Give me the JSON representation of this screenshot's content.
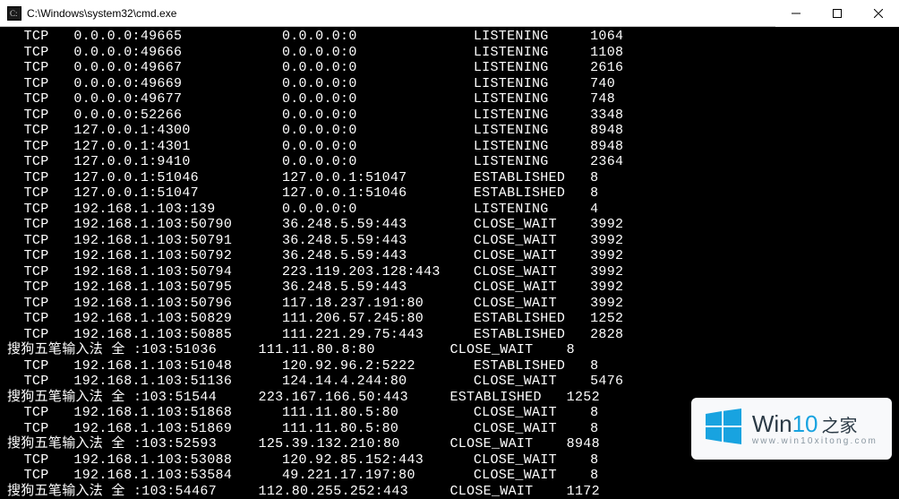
{
  "window": {
    "title": "C:\\Windows\\system32\\cmd.exe"
  },
  "columns": {
    "col1_width": 8,
    "col2_width": 25,
    "col3_width": 23,
    "col4_width": 14
  },
  "rows": [
    {
      "proto": "  TCP",
      "local": "0.0.0.0:49665",
      "remote": "0.0.0.0:0",
      "state": "LISTENING",
      "pid": "1064"
    },
    {
      "proto": "  TCP",
      "local": "0.0.0.0:49666",
      "remote": "0.0.0.0:0",
      "state": "LISTENING",
      "pid": "1108"
    },
    {
      "proto": "  TCP",
      "local": "0.0.0.0:49667",
      "remote": "0.0.0.0:0",
      "state": "LISTENING",
      "pid": "2616"
    },
    {
      "proto": "  TCP",
      "local": "0.0.0.0:49669",
      "remote": "0.0.0.0:0",
      "state": "LISTENING",
      "pid": "740"
    },
    {
      "proto": "  TCP",
      "local": "0.0.0.0:49677",
      "remote": "0.0.0.0:0",
      "state": "LISTENING",
      "pid": "748"
    },
    {
      "proto": "  TCP",
      "local": "0.0.0.0:52266",
      "remote": "0.0.0.0:0",
      "state": "LISTENING",
      "pid": "3348"
    },
    {
      "proto": "  TCP",
      "local": "127.0.0.1:4300",
      "remote": "0.0.0.0:0",
      "state": "LISTENING",
      "pid": "8948"
    },
    {
      "proto": "  TCP",
      "local": "127.0.0.1:4301",
      "remote": "0.0.0.0:0",
      "state": "LISTENING",
      "pid": "8948"
    },
    {
      "proto": "  TCP",
      "local": "127.0.0.1:9410",
      "remote": "0.0.0.0:0",
      "state": "LISTENING",
      "pid": "2364"
    },
    {
      "proto": "  TCP",
      "local": "127.0.0.1:51046",
      "remote": "127.0.0.1:51047",
      "state": "ESTABLISHED",
      "pid": "8"
    },
    {
      "proto": "  TCP",
      "local": "127.0.0.1:51047",
      "remote": "127.0.0.1:51046",
      "state": "ESTABLISHED",
      "pid": "8"
    },
    {
      "proto": "  TCP",
      "local": "192.168.1.103:139",
      "remote": "0.0.0.0:0",
      "state": "LISTENING",
      "pid": "4"
    },
    {
      "proto": "  TCP",
      "local": "192.168.1.103:50790",
      "remote": "36.248.5.59:443",
      "state": "CLOSE_WAIT",
      "pid": "3992"
    },
    {
      "proto": "  TCP",
      "local": "192.168.1.103:50791",
      "remote": "36.248.5.59:443",
      "state": "CLOSE_WAIT",
      "pid": "3992"
    },
    {
      "proto": "  TCP",
      "local": "192.168.1.103:50792",
      "remote": "36.248.5.59:443",
      "state": "CLOSE_WAIT",
      "pid": "3992"
    },
    {
      "proto": "  TCP",
      "local": "192.168.1.103:50794",
      "remote": "223.119.203.128:443",
      "state": "CLOSE_WAIT",
      "pid": "3992"
    },
    {
      "proto": "  TCP",
      "local": "192.168.1.103:50795",
      "remote": "36.248.5.59:443",
      "state": "CLOSE_WAIT",
      "pid": "3992"
    },
    {
      "proto": "  TCP",
      "local": "192.168.1.103:50796",
      "remote": "117.18.237.191:80",
      "state": "CLOSE_WAIT",
      "pid": "3992"
    },
    {
      "proto": "  TCP",
      "local": "192.168.1.103:50829",
      "remote": "111.206.57.245:80",
      "state": "ESTABLISHED",
      "pid": "1252"
    },
    {
      "proto": "  TCP",
      "local": "192.168.1.103:50885",
      "remote": "111.221.29.75:443",
      "state": "ESTABLISHED",
      "pid": "2828"
    },
    {
      "proto": "搜狗五笔输入法 全 :103:51036",
      "local": "",
      "remote": "111.11.80.8:80",
      "state": "CLOSE_WAIT",
      "pid": "8",
      "raw": true
    },
    {
      "proto": "  TCP",
      "local": "192.168.1.103:51048",
      "remote": "120.92.96.2:5222",
      "state": "ESTABLISHED",
      "pid": "8"
    },
    {
      "proto": "  TCP",
      "local": "192.168.1.103:51136",
      "remote": "124.14.4.244:80",
      "state": "CLOSE_WAIT",
      "pid": "5476"
    },
    {
      "proto": "搜狗五笔输入法 全 :103:51544",
      "local": "",
      "remote": "223.167.166.50:443",
      "state": "ESTABLISHED",
      "pid": "1252",
      "raw": true
    },
    {
      "proto": "  TCP",
      "local": "192.168.1.103:51868",
      "remote": "111.11.80.5:80",
      "state": "CLOSE_WAIT",
      "pid": "8"
    },
    {
      "proto": "  TCP",
      "local": "192.168.1.103:51869",
      "remote": "111.11.80.5:80",
      "state": "CLOSE_WAIT",
      "pid": "8"
    },
    {
      "proto": "搜狗五笔输入法 全 :103:52593",
      "local": "",
      "remote": "125.39.132.210:80",
      "state": "CLOSE_WAIT",
      "pid": "8948",
      "raw": true
    },
    {
      "proto": "  TCP",
      "local": "192.168.1.103:53088",
      "remote": "120.92.85.152:443",
      "state": "CLOSE_WAIT",
      "pid": "8"
    },
    {
      "proto": "  TCP",
      "local": "192.168.1.103:53584",
      "remote": "49.221.17.197:80",
      "state": "CLOSE_WAIT",
      "pid": "8"
    },
    {
      "proto": "搜狗五笔输入法 全 :103:54467",
      "local": "",
      "remote": "112.80.255.252:443",
      "state": "CLOSE_WAIT",
      "pid": "1172",
      "raw": true
    }
  ],
  "watermark": {
    "brand_prefix": "Win",
    "brand_number": "10",
    "brand_suffix": "之家",
    "url": "www.win10xitong.com",
    "logo_color": "#18a3e0"
  }
}
